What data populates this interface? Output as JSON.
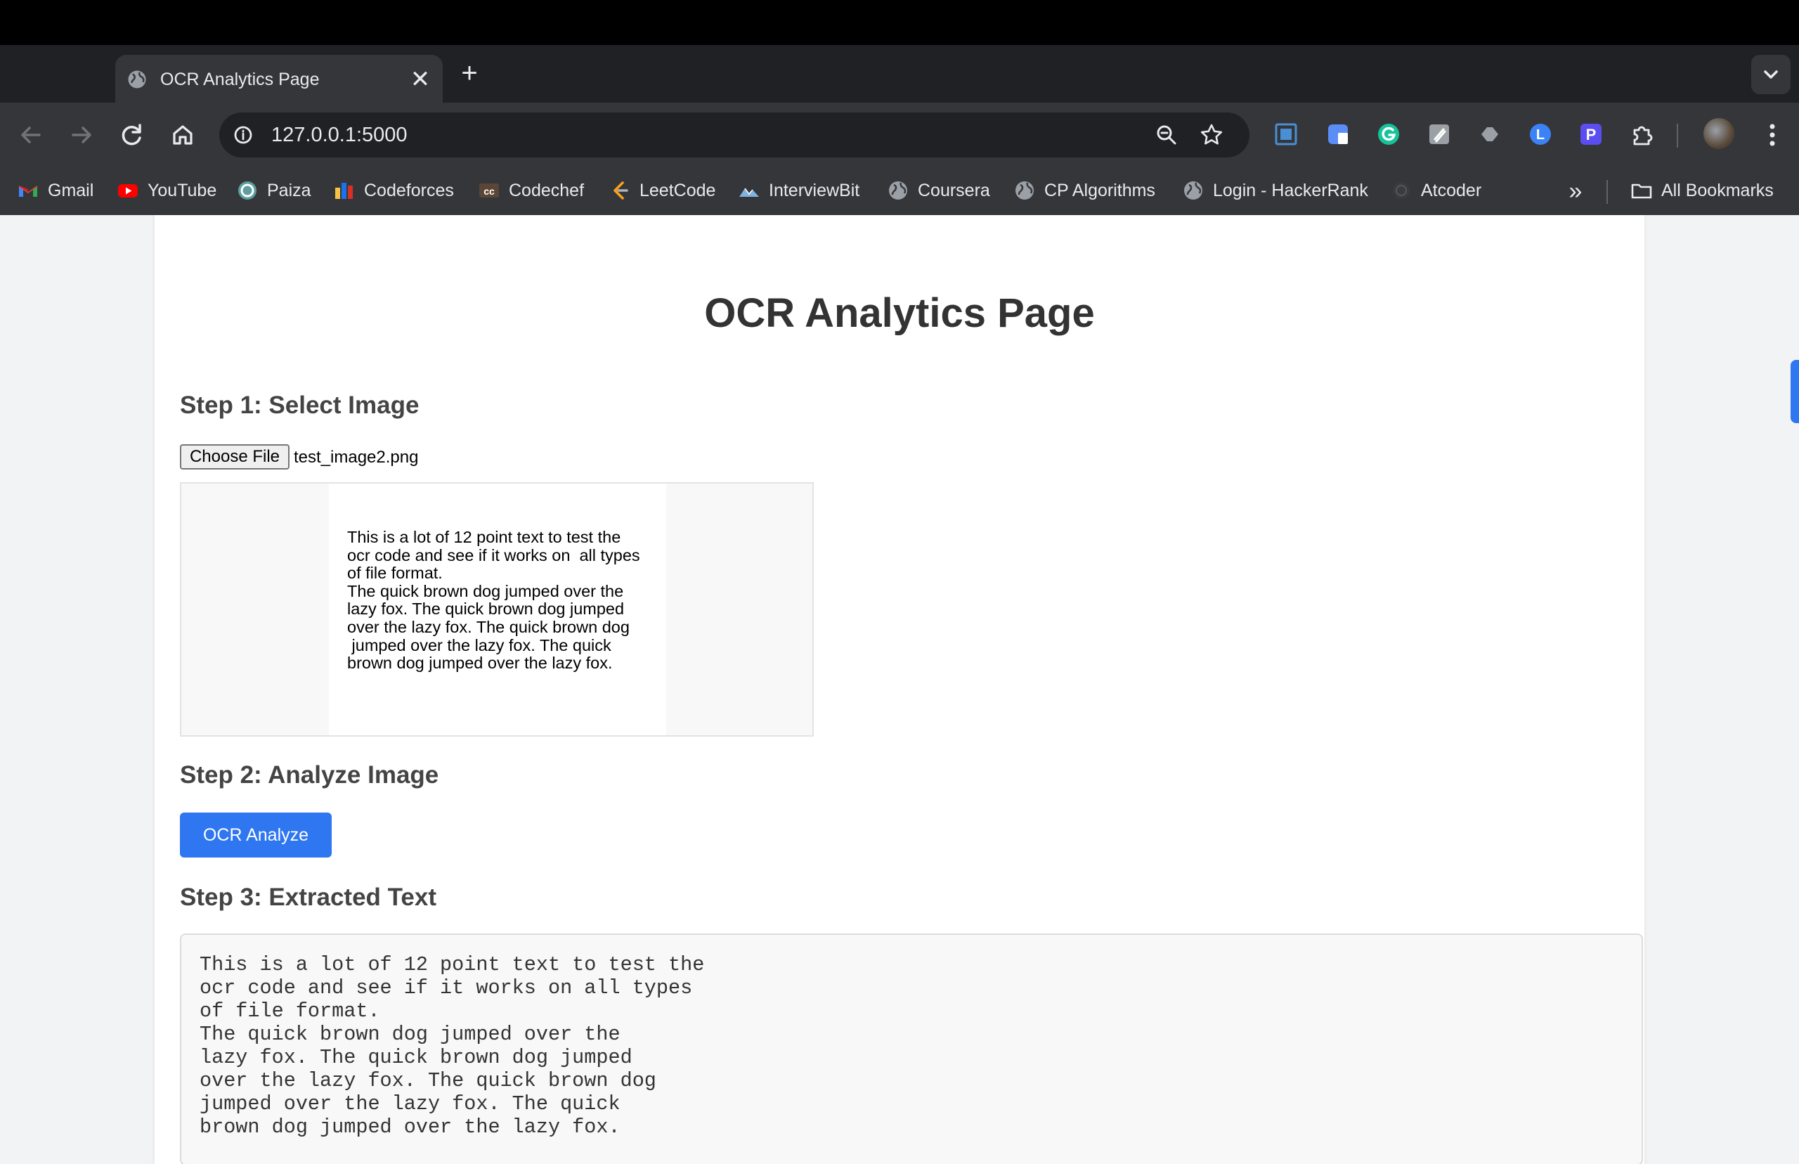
{
  "browser": {
    "tab": {
      "title": "OCR Analytics Page",
      "close_glyph": "✕"
    },
    "new_tab_glyph": "+",
    "omnibox": {
      "url": "127.0.0.1:5000"
    },
    "bookmarks": [
      {
        "label": "Gmail",
        "icon": "gmail-icon"
      },
      {
        "label": "YouTube",
        "icon": "youtube-icon"
      },
      {
        "label": "Paiza",
        "icon": "paiza-icon"
      },
      {
        "label": "Codeforces",
        "icon": "codeforces-icon"
      },
      {
        "label": "Codechef",
        "icon": "codechef-icon"
      },
      {
        "label": "LeetCode",
        "icon": "leetcode-icon"
      },
      {
        "label": "InterviewBit",
        "icon": "interviewbit-icon"
      },
      {
        "label": "Coursera",
        "icon": "globe-icon"
      },
      {
        "label": "CP Algorithms",
        "icon": "globe-icon"
      },
      {
        "label": "Login - HackerRank",
        "icon": "globe-icon"
      },
      {
        "label": "Atcoder",
        "icon": "atcoder-icon"
      }
    ],
    "bookmarks_more_glyph": "»",
    "all_bookmarks": "All Bookmarks"
  },
  "page": {
    "title": "OCR Analytics Page",
    "step1": {
      "heading": "Step 1: Select Image",
      "choose_file_label": "Choose File",
      "file_name": "test_image2.png",
      "preview_text": "This is a lot of 12 point text to test the\nocr code and see if it works on  all types\nof file format.\nThe quick brown dog jumped over the\nlazy fox. The quick brown dog jumped\nover the lazy fox. The quick brown dog\n jumped over the lazy fox. The quick\nbrown dog jumped over the lazy fox."
    },
    "step2": {
      "heading": "Step 2: Analyze Image",
      "button_label": "OCR Analyze"
    },
    "step3": {
      "heading": "Step 3: Extracted Text",
      "extracted_text": "This is a lot of 12 point text to test the\nocr code and see if it works on all types\nof file format.\nThe quick brown dog jumped over the\nlazy fox. The quick brown dog jumped\nover the lazy fox. The quick brown dog\njumped over the lazy fox. The quick\nbrown dog jumped over the lazy fox."
    }
  },
  "colors": {
    "accent": "#2f76f1",
    "chrome_dark": "#202124",
    "chrome_toolbar": "#35363a",
    "page_background": "#f1f3f5"
  }
}
